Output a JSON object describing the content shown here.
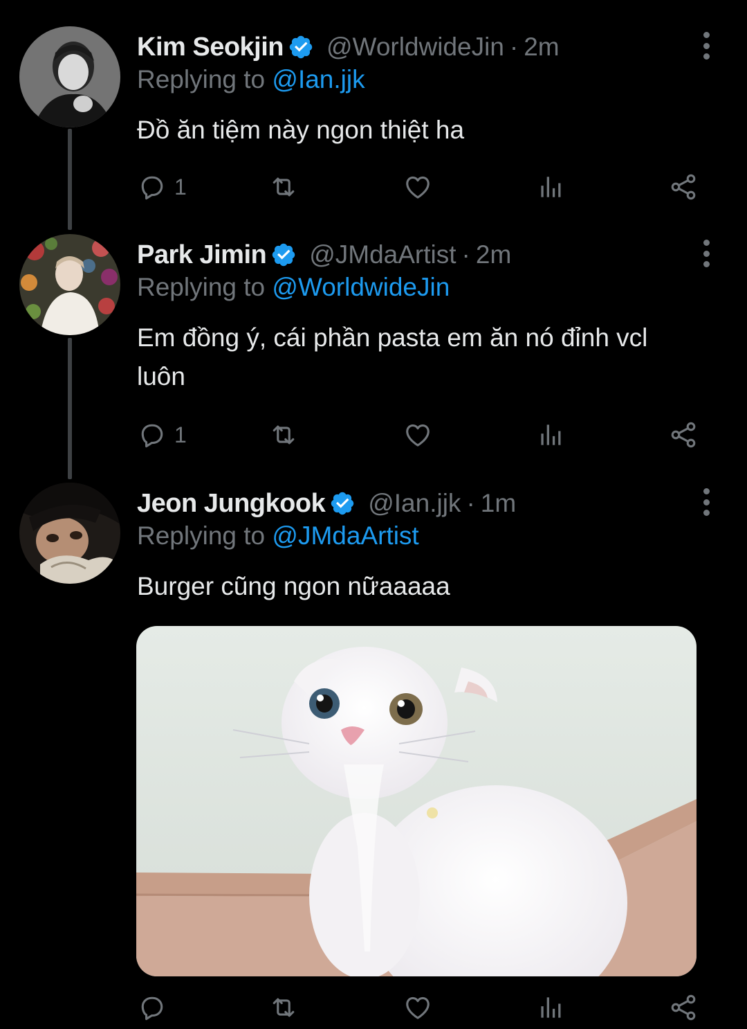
{
  "colors": {
    "background": "#000000",
    "text_primary": "#e7e9ea",
    "text_secondary": "#71767b",
    "link_blue": "#1d9bf0",
    "thread_line": "#3e4144"
  },
  "tweets": [
    {
      "name": "Kim Seokjin",
      "handle": "@WorldwideJin",
      "separator": "·",
      "time": "2m",
      "replying_prefix": "Replying to",
      "replying_to": "@Ian.jjk",
      "text": "Đồ ăn tiệm này ngon thiệt ha",
      "reply_count": "1",
      "icons": [
        "verified-icon",
        "more-icon",
        "reply-icon",
        "retweet-icon",
        "like-icon",
        "views-icon",
        "share-icon"
      ]
    },
    {
      "name": "Park Jimin",
      "handle": "@JMdaArtist",
      "separator": "·",
      "time": "2m",
      "replying_prefix": "Replying to",
      "replying_to": "@WorldwideJin",
      "text": "Em đồng ý, cái phần pasta em ăn nó đỉnh vcl luôn",
      "reply_count": "1",
      "icons": [
        "verified-icon",
        "more-icon",
        "reply-icon",
        "retweet-icon",
        "like-icon",
        "views-icon",
        "share-icon"
      ]
    },
    {
      "name": "Jeon Jungkook",
      "handle": "@Ian.jjk",
      "separator": "·",
      "time": "1m",
      "replying_prefix": "Replying to",
      "replying_to": "@JMdaArtist",
      "text": "Burger cũng ngon nữaaaaa",
      "reply_count": "",
      "media": "white-cat-photo",
      "icons": [
        "verified-icon",
        "more-icon",
        "reply-icon",
        "retweet-icon",
        "like-icon",
        "views-icon",
        "share-icon"
      ]
    }
  ]
}
